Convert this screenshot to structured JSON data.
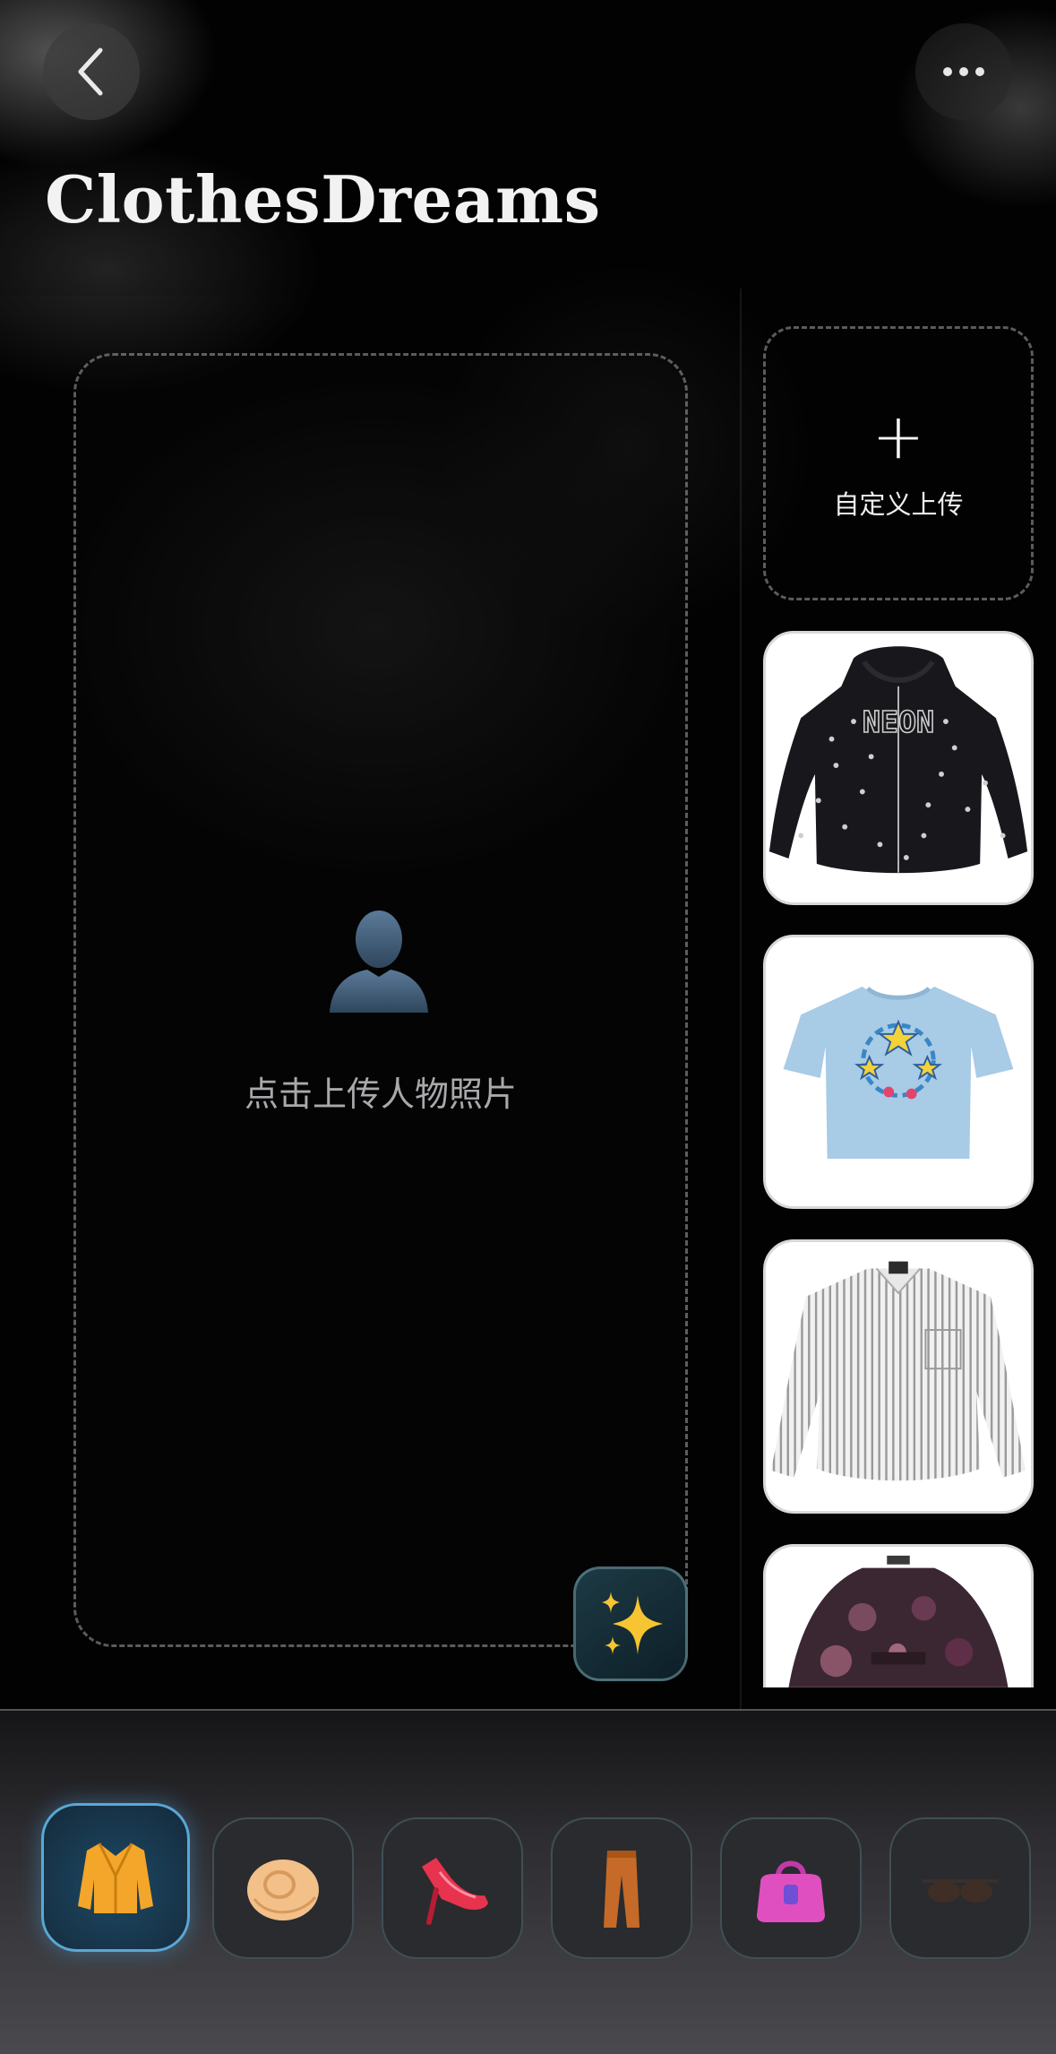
{
  "header": {
    "title": "ClothesDreams"
  },
  "upload_area": {
    "hint": "点击上传人物照片"
  },
  "side_panel": {
    "custom_upload_label": "自定义上传",
    "items": [
      {
        "name": "black-star-hoodie",
        "print_text": "NEON"
      },
      {
        "name": "light-blue-graphic-tee"
      },
      {
        "name": "striped-shirt"
      },
      {
        "name": "floral-blouse"
      }
    ]
  },
  "categories": [
    {
      "name": "tops",
      "icon": "jacket-icon",
      "active": true
    },
    {
      "name": "hats",
      "icon": "hat-icon",
      "active": false
    },
    {
      "name": "shoes",
      "icon": "high-heel-icon",
      "active": false
    },
    {
      "name": "pants",
      "icon": "pants-icon",
      "active": false
    },
    {
      "name": "bags",
      "icon": "handbag-icon",
      "active": false
    },
    {
      "name": "glasses",
      "icon": "sunglasses-icon",
      "active": false
    }
  ],
  "colors": {
    "accent": "#5aa7d6",
    "background": "#020203"
  }
}
